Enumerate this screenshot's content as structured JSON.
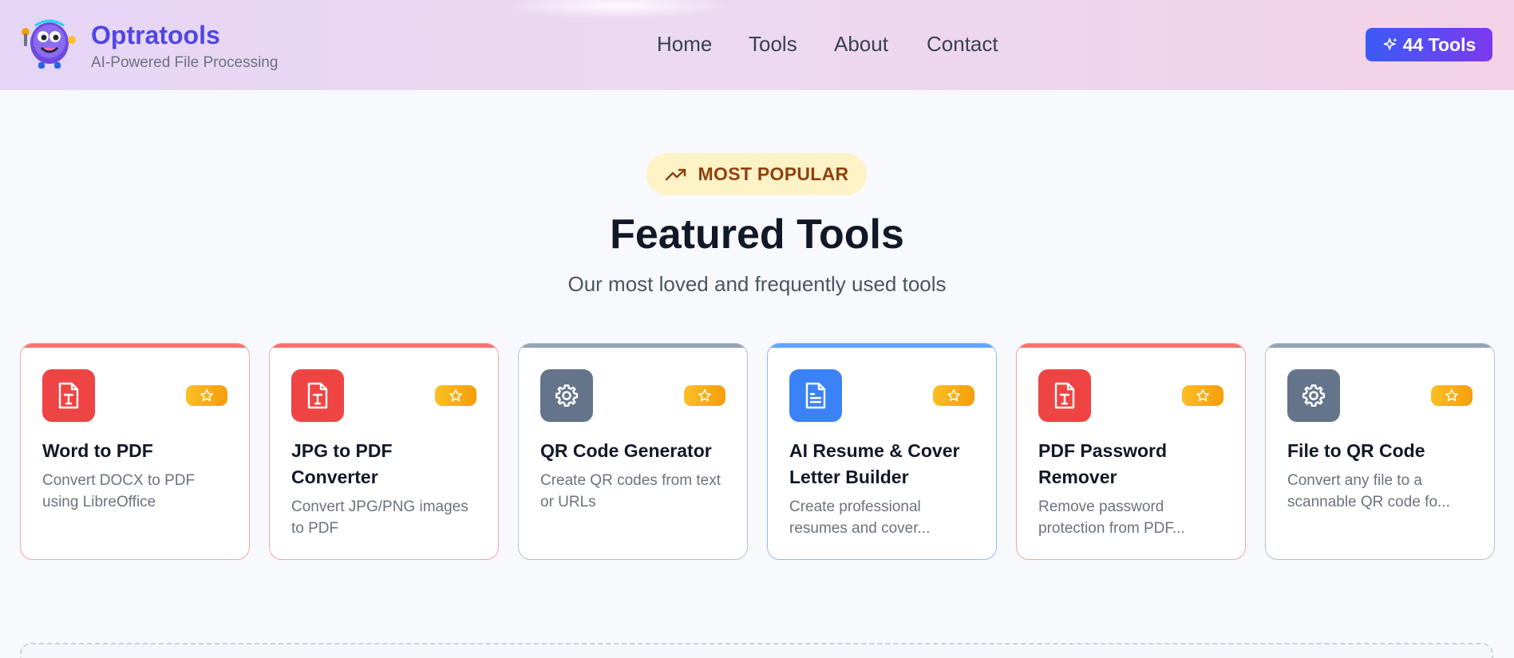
{
  "brand": {
    "name": "Optratools",
    "tagline": "AI-Powered File Processing"
  },
  "nav": [
    {
      "label": "Home"
    },
    {
      "label": "Tools"
    },
    {
      "label": "About"
    },
    {
      "label": "Contact"
    }
  ],
  "tools_badge": {
    "label": "44 Tools",
    "icon": "sparkles-icon"
  },
  "section": {
    "badge": "MOST POPULAR",
    "badge_icon": "trending-up-icon",
    "title": "Featured Tools",
    "subtitle": "Our most loved and frequently used tools"
  },
  "cards": [
    {
      "title": "Word to PDF",
      "description": "Convert DOCX to PDF using LibreOffice",
      "icon": "file-type-icon",
      "accent": "#ef4444"
    },
    {
      "title": "JPG to PDF Converter",
      "description": "Convert JPG/PNG images to PDF",
      "icon": "file-type-icon",
      "accent": "#ef4444"
    },
    {
      "title": "QR Code Generator",
      "description": "Create QR codes from text or URLs",
      "icon": "gear-icon",
      "accent": "#64748b"
    },
    {
      "title": "AI Resume & Cover Letter Builder",
      "description": "Create professional resumes and cover...",
      "icon": "document-icon",
      "accent": "#3b82f6"
    },
    {
      "title": "PDF Password Remover",
      "description": "Remove password protection from PDF...",
      "icon": "file-type-icon",
      "accent": "#ef4444"
    },
    {
      "title": "File to QR Code",
      "description": "Convert any file to a scannable QR code fo...",
      "icon": "gear-icon",
      "accent": "#64748b"
    }
  ],
  "colors": {
    "brand": "#4f46e5",
    "badge_gradient_start": "#3b5bf6",
    "badge_gradient_end": "#7c3aed",
    "popular_bg": "#fef3c7",
    "popular_text": "#92400e",
    "star_badge": "#fbbf24"
  }
}
